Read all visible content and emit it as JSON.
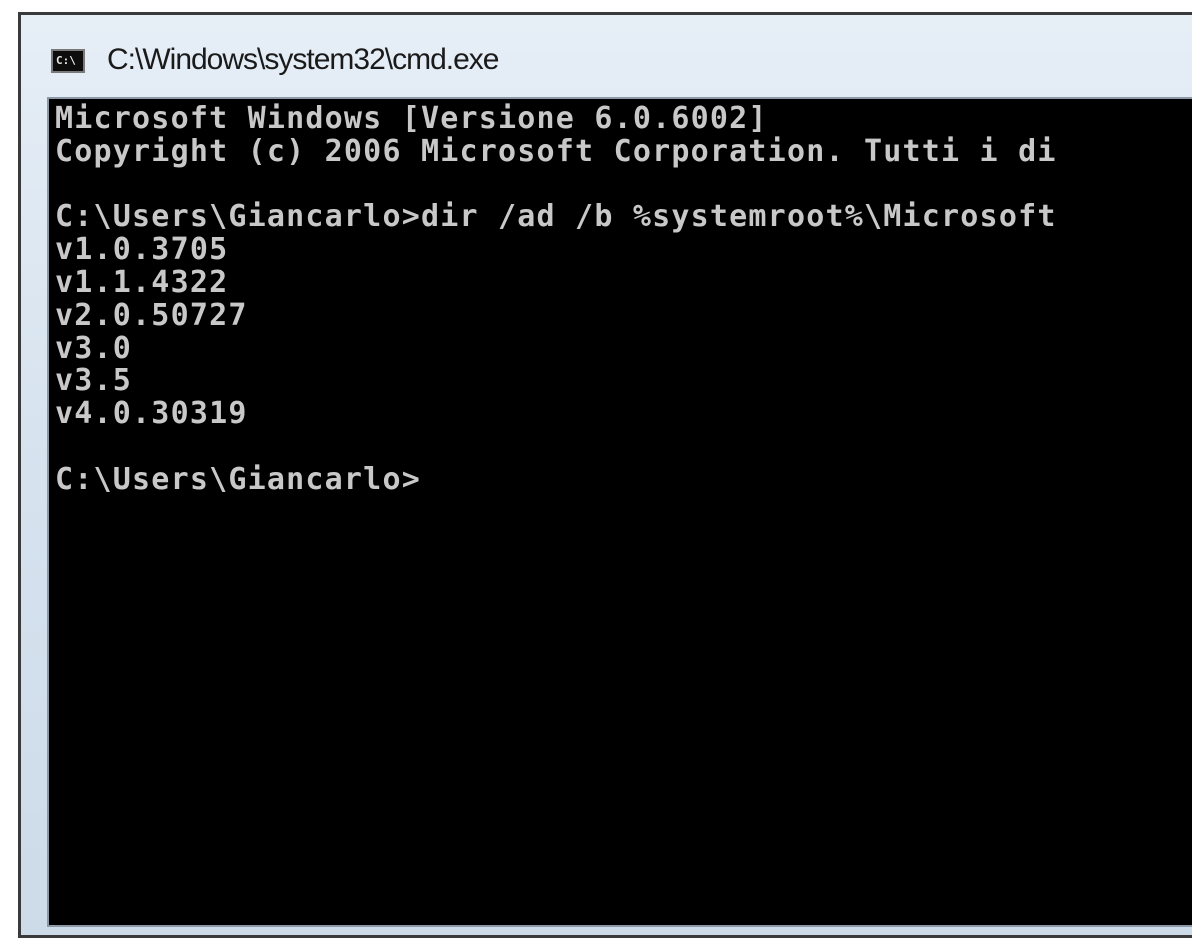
{
  "window": {
    "title": "C:\\Windows\\system32\\cmd.exe",
    "icon": "cmd-icon",
    "icon_text": "C:\\"
  },
  "console": {
    "lines": [
      "Microsoft Windows [Versione 6.0.6002]",
      "Copyright (c) 2006 Microsoft Corporation. Tutti i di",
      "",
      "C:\\Users\\Giancarlo>dir /ad /b %systemroot%\\Microsoft",
      "v1.0.3705",
      "v1.1.4322",
      "v2.0.50727",
      "v3.0",
      "v3.5",
      "v4.0.30319",
      "",
      "C:\\Users\\Giancarlo>"
    ]
  },
  "colors": {
    "console_bg": "#000000",
    "console_text": "#c8c8c8",
    "titlebar": "#d7e3ef"
  }
}
